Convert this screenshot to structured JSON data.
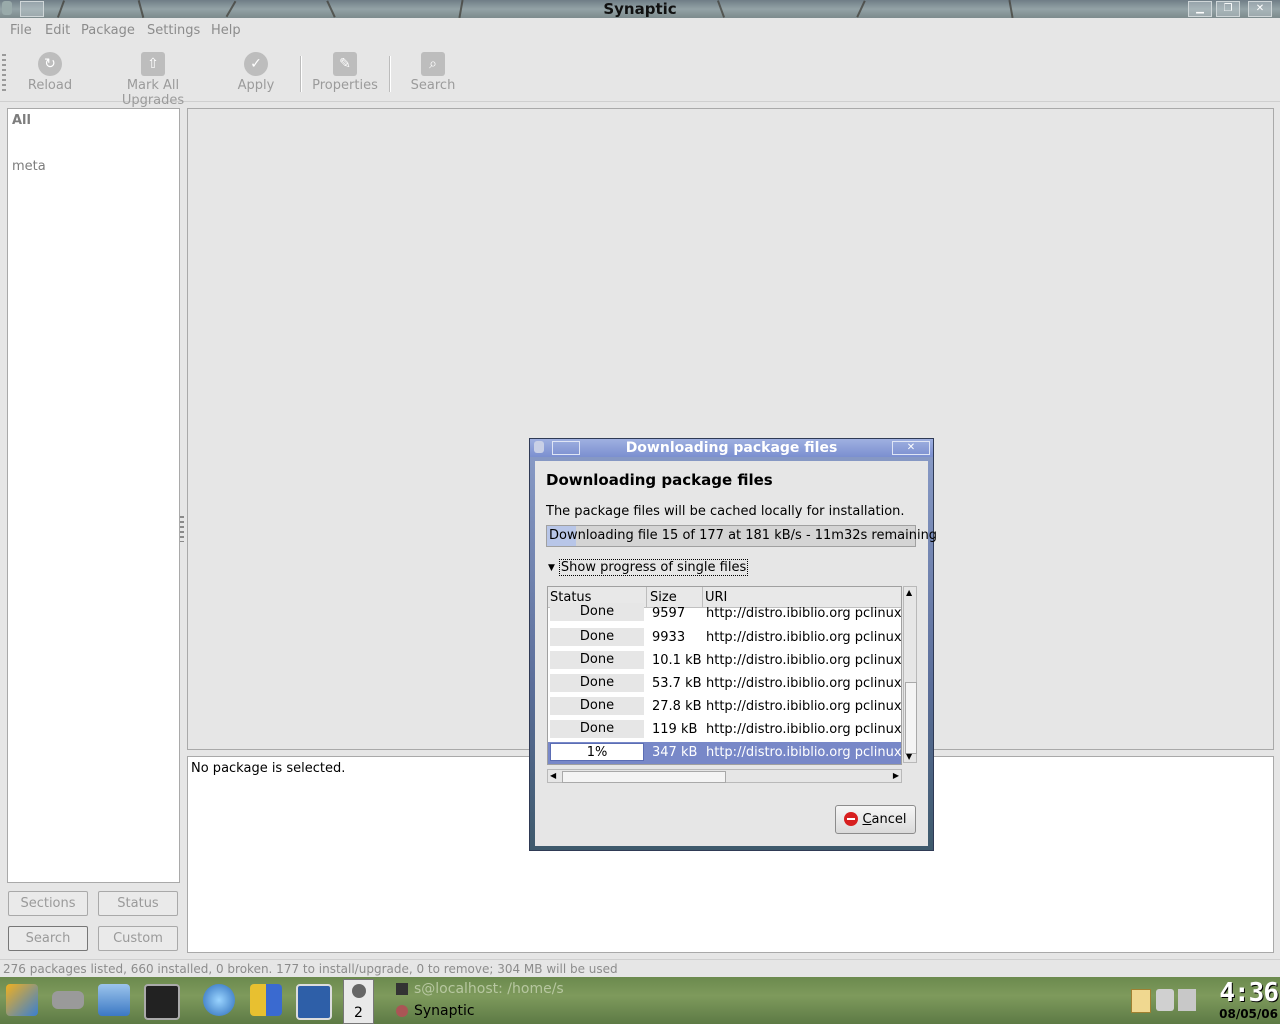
{
  "window": {
    "title": "Synaptic"
  },
  "menu": [
    "File",
    "Edit",
    "Package",
    "Settings",
    "Help"
  ],
  "toolbar": {
    "reload": "Reload",
    "mark_all_upgrades": "Mark All Upgrades",
    "apply": "Apply",
    "properties": "Properties",
    "search": "Search"
  },
  "filters": {
    "all": "All",
    "meta": "meta"
  },
  "left_buttons": {
    "sections": "Sections",
    "status": "Status",
    "search": "Search",
    "custom": "Custom"
  },
  "details": {
    "text": "No package is selected."
  },
  "statusbar": {
    "text": "276 packages listed, 660 installed, 0 broken. 177 to install/upgrade, 0 to remove; 304 MB will be used"
  },
  "taskbar": {
    "pager_number": "2",
    "tasks": [
      "s@localhost: /home/s",
      "Synaptic"
    ],
    "clock_time": "4:36",
    "clock_date": "08/05/06"
  },
  "dialog": {
    "title": "Downloading package files",
    "heading": "Downloading package files",
    "message": "The package files will be cached locally for installation.",
    "progress_text": "Downloading file 15 of 177 at 181 kB/s - 11m32s remaining",
    "progress_fraction": 0.08,
    "expander_label": "Show progress of single files",
    "columns": {
      "status": "Status",
      "size": "Size",
      "uri": "URI"
    },
    "rows": [
      {
        "status": "Done",
        "size": "9597",
        "uri": "http://distro.ibiblio.org pclinuxo"
      },
      {
        "status": "Done",
        "size": "9933",
        "uri": "http://distro.ibiblio.org pclinuxo"
      },
      {
        "status": "Done",
        "size": "10.1 kB",
        "uri": "http://distro.ibiblio.org pclinuxo"
      },
      {
        "status": "Done",
        "size": "53.7 kB",
        "uri": "http://distro.ibiblio.org pclinuxo"
      },
      {
        "status": "Done",
        "size": "27.8 kB",
        "uri": "http://distro.ibiblio.org pclinuxo"
      },
      {
        "status": "Done",
        "size": "119 kB",
        "uri": "http://distro.ibiblio.org pclinuxo"
      },
      {
        "status": "1%",
        "size": "347 kB",
        "uri": "http://distro.ibiblio.org pclinuxo"
      }
    ],
    "cancel_label": "Cancel"
  },
  "colors": {
    "selection": "#7888c8",
    "dialog_title": "#7b8fd0",
    "cancel_icon": "#d71f1f"
  }
}
